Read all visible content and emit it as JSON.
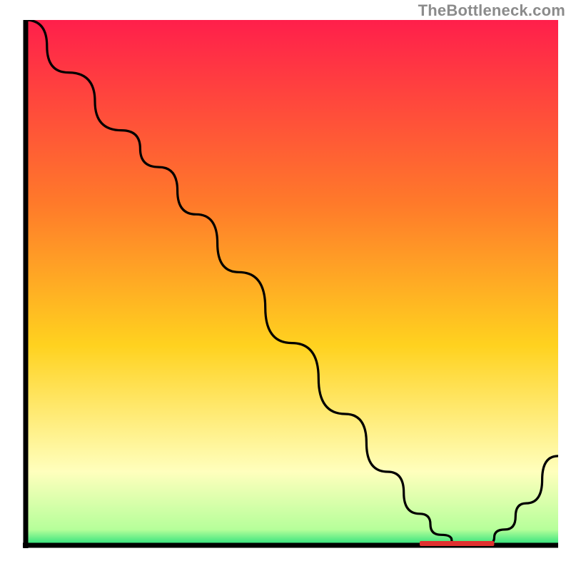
{
  "watermark": "TheBottleneck.com",
  "colors": {
    "gradient_top": "#ff1f4b",
    "gradient_upper_mid": "#ff7a2a",
    "gradient_mid": "#ffd21f",
    "gradient_pale": "#ffffbd",
    "gradient_green": "#27e07a",
    "axis": "#000000",
    "curve": "#000000",
    "marker": "#e03030"
  },
  "chart_data": {
    "type": "line",
    "title": "",
    "xlabel": "",
    "ylabel": "",
    "xlim": [
      0,
      100
    ],
    "ylim": [
      0,
      100
    ],
    "series": [
      {
        "name": "bottleneck-curve",
        "x": [
          0,
          8,
          18,
          25,
          32,
          40,
          50,
          60,
          68,
          74,
          78,
          82,
          86,
          90,
          94,
          100
        ],
        "values": [
          100,
          90,
          79,
          72,
          63,
          52,
          38.5,
          25,
          14,
          6,
          2,
          0,
          0,
          3,
          8,
          17
        ]
      }
    ],
    "annotations": [
      {
        "name": "optimal-range",
        "x_start": 74,
        "x_end": 88,
        "y": 0,
        "label": ""
      }
    ]
  }
}
